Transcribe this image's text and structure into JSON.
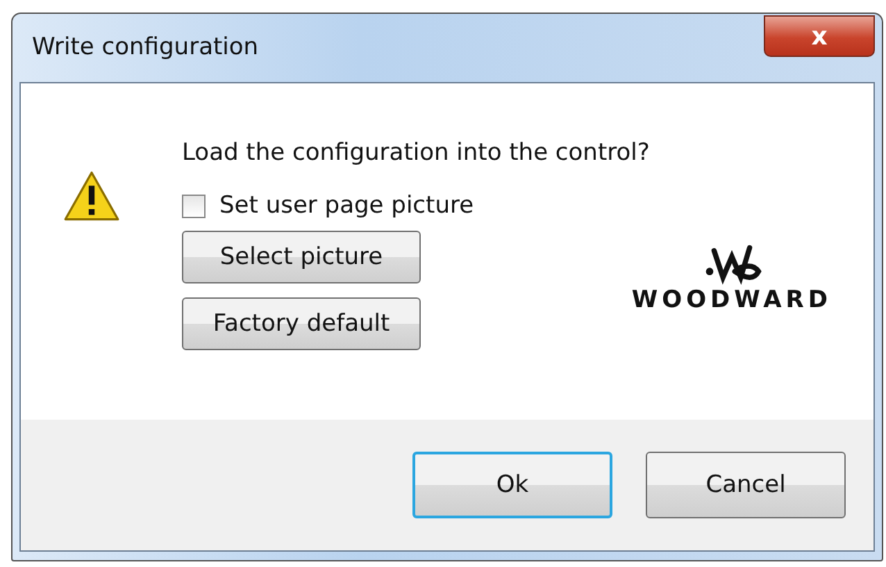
{
  "window": {
    "title": "Write configuration",
    "close_glyph": "x"
  },
  "message": "Load the configuration into the control?",
  "checkbox": {
    "label": "Set user page picture",
    "checked": false
  },
  "side_buttons": [
    "Select picture",
    "Factory default"
  ],
  "logo": {
    "text": "WOODWARD"
  },
  "buttons": [
    {
      "label": "Ok",
      "focused": true
    },
    {
      "label": "Cancel",
      "focused": false
    }
  ]
}
